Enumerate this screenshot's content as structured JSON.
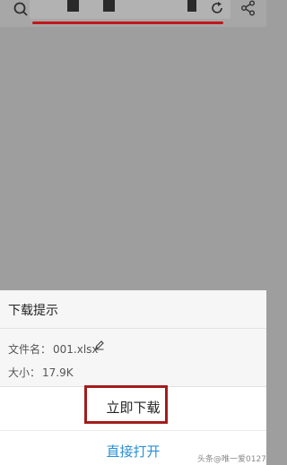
{
  "browser": {
    "icons": [
      "search-icon",
      "refresh-icon",
      "share-icon"
    ]
  },
  "dialog": {
    "title": "下载提示",
    "filename_label": "文件名：",
    "filename_value": "001.xlsx",
    "size_label": "大小：",
    "size_value": "17.9K",
    "download_label": "立即下载",
    "open_label": "直接打开"
  },
  "watermark": "头条@唯一爱0127",
  "colors": {
    "highlight_red": "#a31c1c",
    "link_blue": "#2a8fd6",
    "underline_red": "#c0171c"
  }
}
